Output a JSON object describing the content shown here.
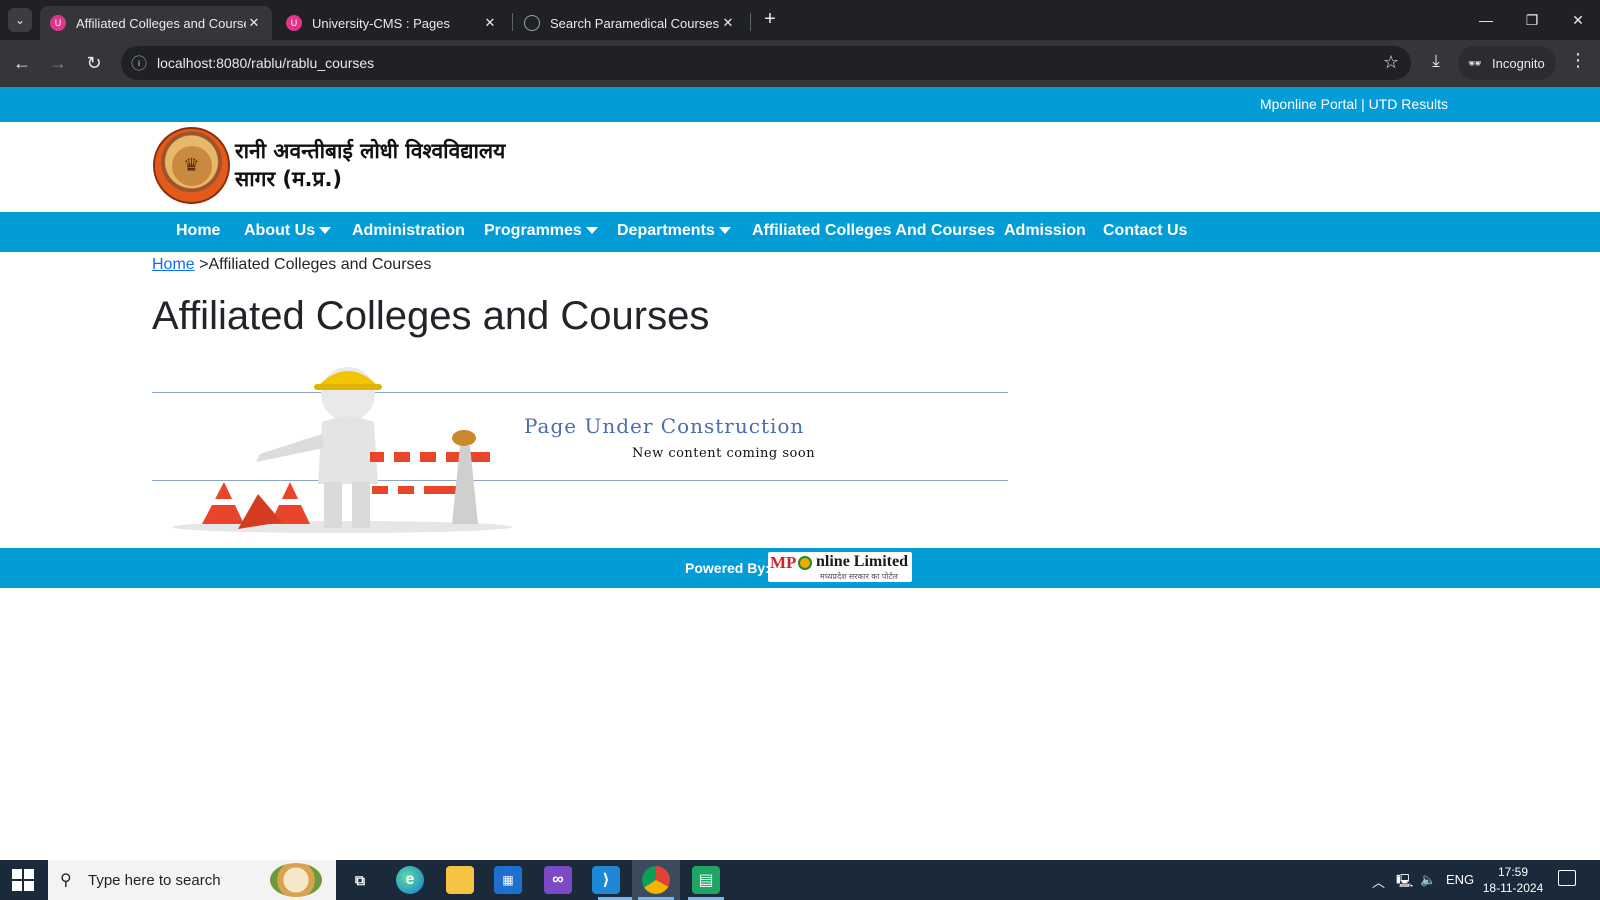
{
  "browser": {
    "tabs": [
      {
        "title": "Affiliated Colleges and Courses",
        "active": true,
        "favicon": "university-favicon"
      },
      {
        "title": "University-CMS : Pages",
        "active": false,
        "favicon": "university-favicon"
      },
      {
        "title": "Search Paramedical Courses",
        "active": false,
        "favicon": "globe-icon"
      }
    ],
    "url": "localhost:8080/rablu/rablu_courses",
    "incognito_label": "Incognito"
  },
  "site": {
    "top_links": "Mponline Portal | UTD Results",
    "name_line1": "रानी अवन्तीबाई लोधी विश्वविद्यालय",
    "name_line2": "सागर (म.प्र.)",
    "nav": {
      "home": "Home",
      "about": "About Us",
      "administration": "Administration",
      "programmes": "Programmes",
      "departments": "Departments",
      "affiliated": "Affiliated Colleges And Courses",
      "admission": "Admission",
      "contact": "Contact Us"
    },
    "breadcrumb": {
      "home": "Home",
      "separator": ">",
      "current": "Affiliated Colleges and Courses"
    },
    "page_title": "Affiliated Colleges and Courses",
    "construction": {
      "title": "Page Under Construction",
      "subtitle": "New content coming soon"
    },
    "footer": {
      "powered_by": "Powered By:",
      "logo_mp": "MP",
      "logo_rest": "nline Limited",
      "logo_tagline": "मध्यप्रदेश सरकार का पोर्टल"
    }
  },
  "taskbar": {
    "search_placeholder": "Type here to search",
    "language": "ENG",
    "time": "17:59",
    "date": "18-11-2024"
  },
  "colors": {
    "brand_blue": "#049cd6",
    "link_blue": "#0d6efd"
  }
}
